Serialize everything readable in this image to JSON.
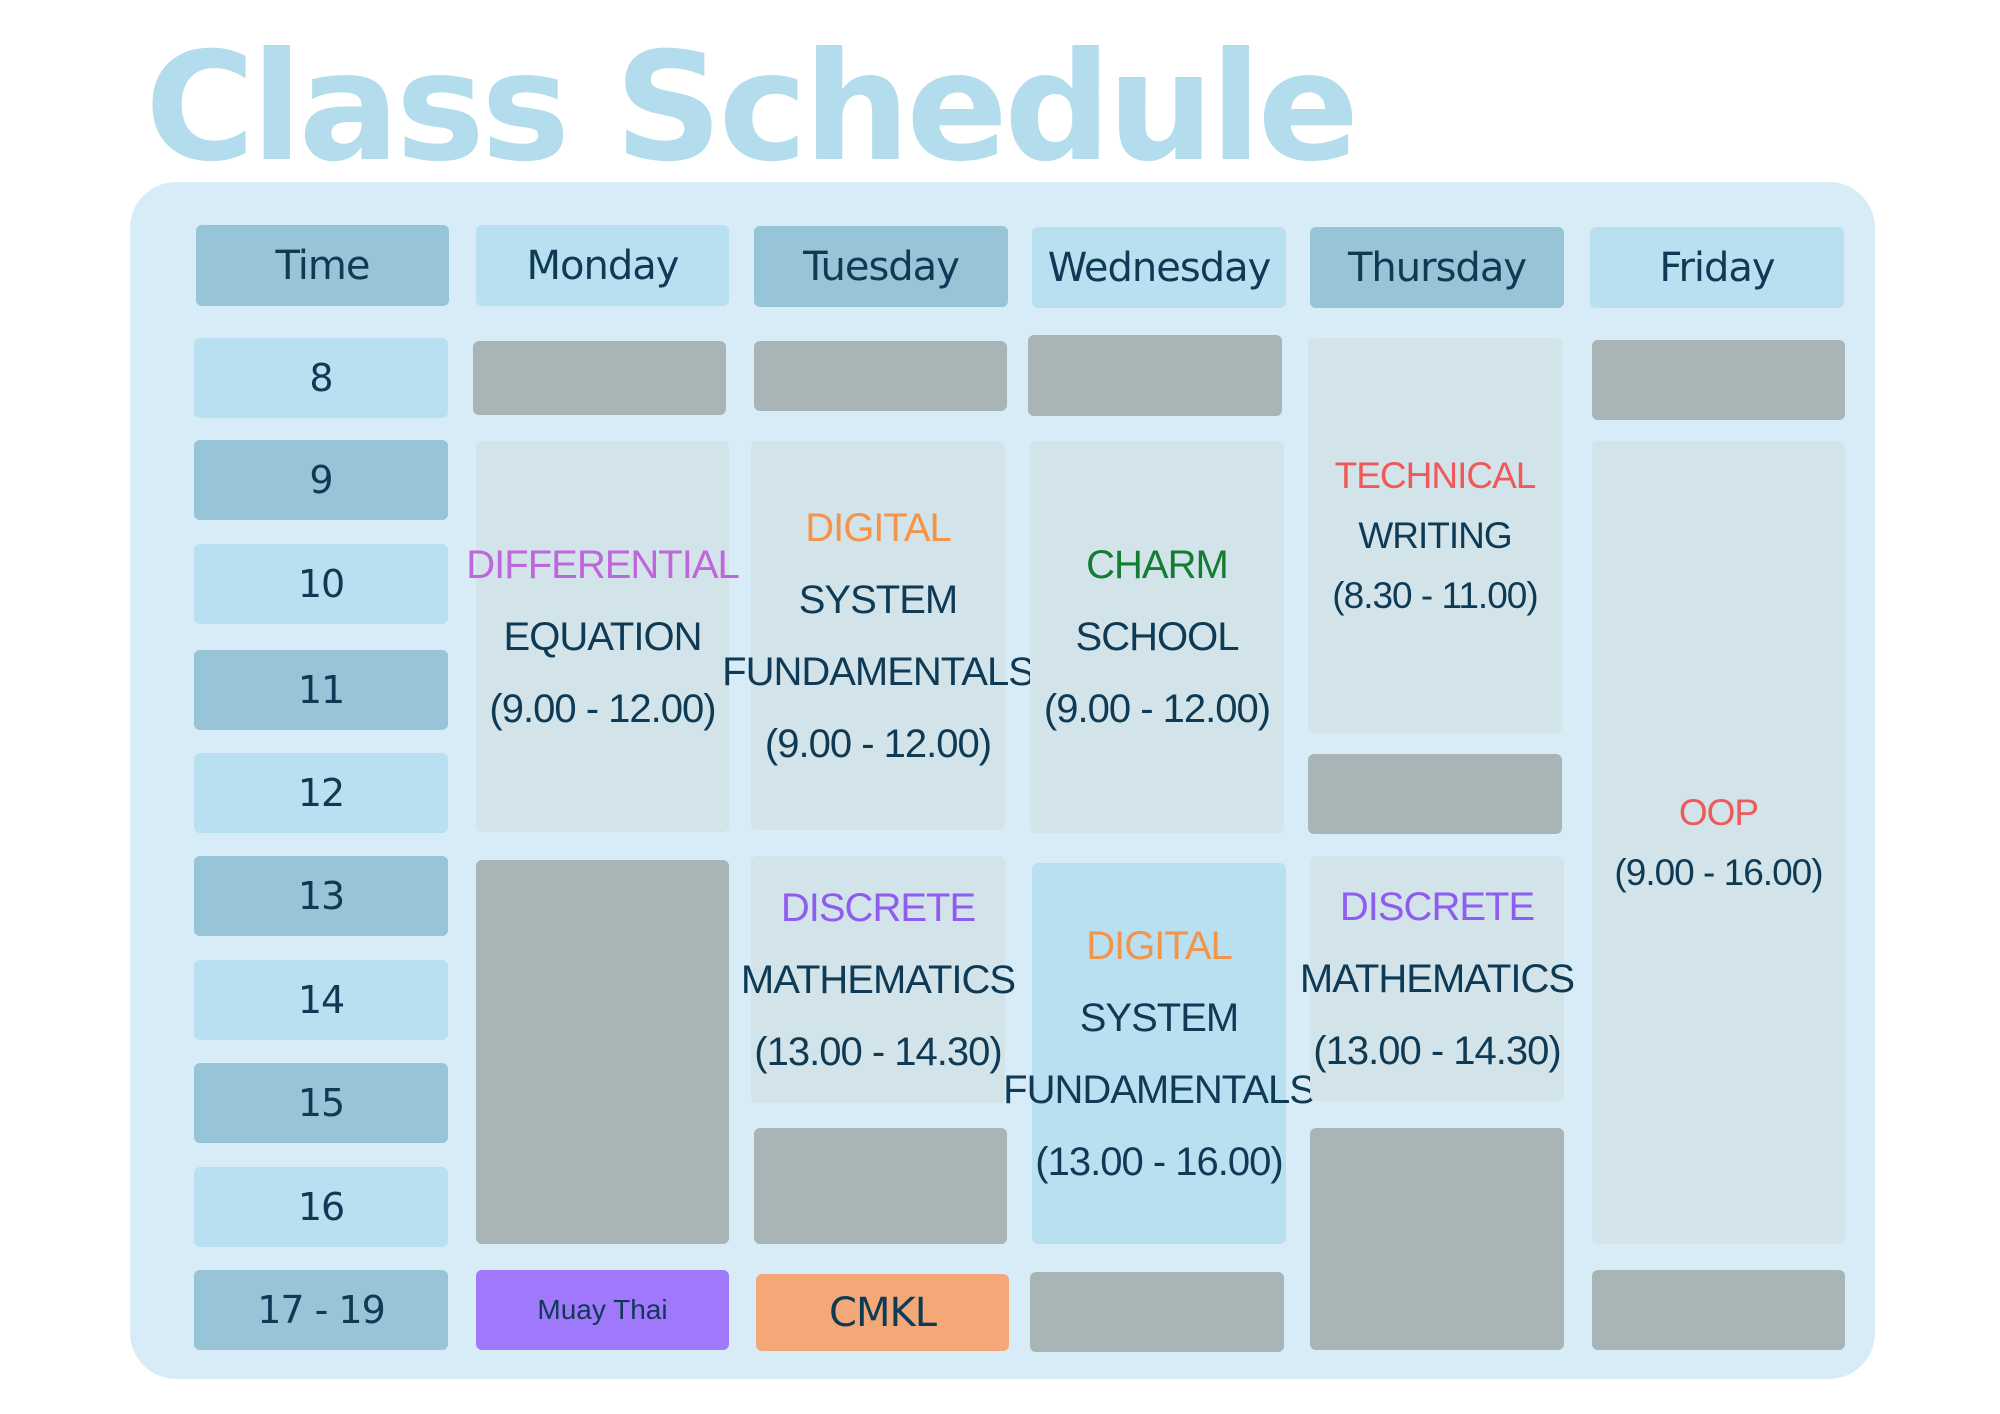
{
  "title": "Class Schedule",
  "headers": [
    "Time",
    "Monday",
    "Tuesday",
    "Wednesday",
    "Thursday",
    "Friday"
  ],
  "times": [
    "8",
    "9",
    "10",
    "11",
    "12",
    "13",
    "14",
    "15",
    "16",
    "17 - 19"
  ],
  "monday": {
    "differential": {
      "line1": "DIFFERENTIAL",
      "line2": "EQUATION",
      "line3": "(9.00 - 12.00)"
    },
    "evening": "Muay Thai"
  },
  "tuesday": {
    "digital": {
      "line1": "DIGITAL",
      "line2": "SYSTEM",
      "line3": "FUNDAMENTALS",
      "line4": "(9.00 - 12.00)"
    },
    "discrete": {
      "line1": "DISCRETE",
      "line2": "MATHEMATICS",
      "line3": "(13.00 - 14.30)"
    },
    "evening": "CMKL"
  },
  "wednesday": {
    "charm": {
      "line1": "CHARM",
      "line2": "SCHOOL",
      "line3": "(9.00 - 12.00)"
    },
    "digital": {
      "line1": "DIGITAL",
      "line2": "SYSTEM",
      "line3": "FUNDAMENTALS",
      "line4": "(13.00 - 16.00)"
    }
  },
  "thursday": {
    "technical": {
      "line1": "TECHNICAL",
      "line2": "WRITING",
      "line3": "(8.30 - 11.00)"
    },
    "discrete": {
      "line1": "DISCRETE",
      "line2": "MATHEMATICS",
      "line3": "(13.00 - 14.30)"
    }
  },
  "friday": {
    "oop": {
      "line1": "OOP",
      "line2": "(9.00 - 16.00)"
    }
  }
}
